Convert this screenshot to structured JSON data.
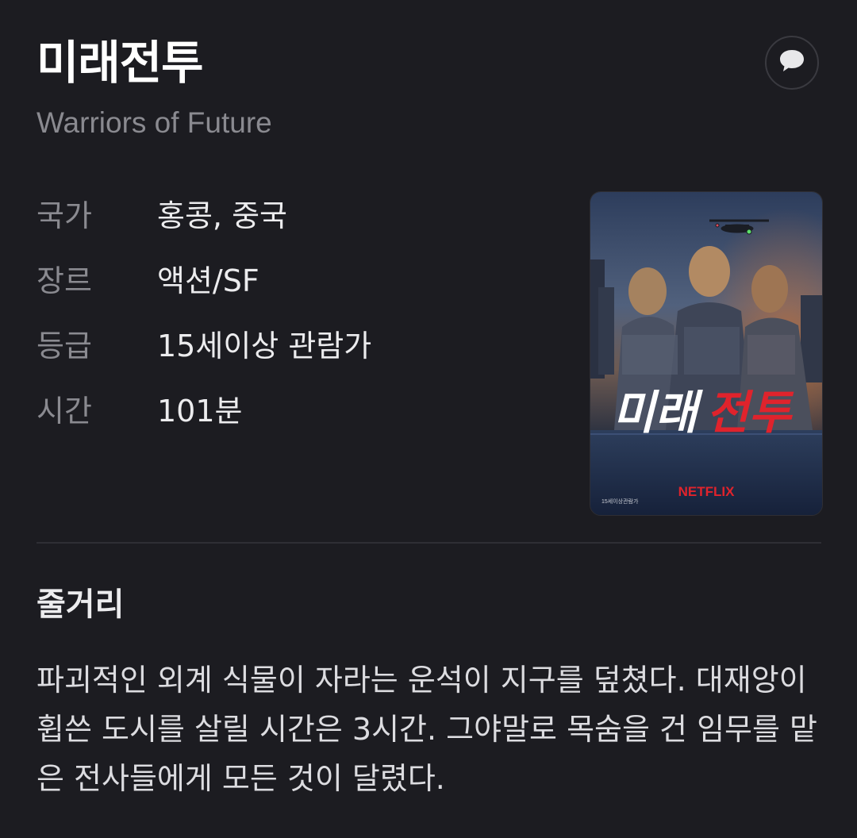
{
  "movie": {
    "title": "미래전투",
    "original_title": "Warriors of Future"
  },
  "icons": {
    "comment": "speech-bubble-icon"
  },
  "info": [
    {
      "label": "국가",
      "value": "홍콩, 중국"
    },
    {
      "label": "장르",
      "value": "액션/SF"
    },
    {
      "label": "등급",
      "value": "15세이상 관람가"
    },
    {
      "label": "시간",
      "value": "101분"
    }
  ],
  "poster": {
    "title_white": "미래",
    "title_red": "전투",
    "brand": "NETFLIX",
    "rating_text": "15세이상관람가"
  },
  "synopsis": {
    "heading": "줄거리",
    "text": "파괴적인 외계 식물이 자라는 운석이 지구를 덮쳤다. 대재앙이 휩쓴 도시를 살릴 시간은 3시간. 그야말로 목숨을 건 임무를 맡은 전사들에게 모든 것이 달렸다."
  },
  "colors": {
    "background": "#1c1c21",
    "accent_red": "#e0232c"
  }
}
